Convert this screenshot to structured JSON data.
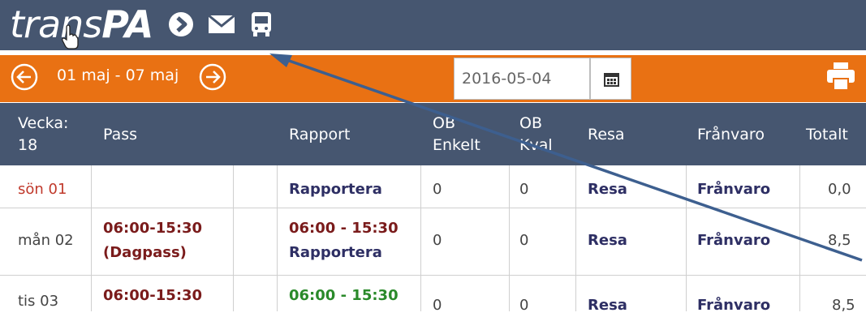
{
  "app": {
    "logo_part1": "trans",
    "logo_part2": "PA"
  },
  "icons": {
    "forward": "chevron-circle-icon",
    "mail": "envelope-icon",
    "bus": "bus-icon",
    "prev": "arrow-left-circle-icon",
    "next": "arrow-right-circle-icon",
    "calendar": "calendar-icon",
    "print": "printer-icon"
  },
  "colors": {
    "header": "#465670",
    "accent": "#e97113",
    "link": "#2e2f64",
    "sunday": "#c0392b",
    "pass": "#7a1b1b",
    "reported": "#2a8a2a"
  },
  "week_nav": {
    "range": "01 maj - 07 maj",
    "date_value": "2016-05-04"
  },
  "table": {
    "headers": {
      "week_line1": "Vecka:",
      "week_line2": "18",
      "pass": "Pass",
      "rapport": "Rapport",
      "ob_enkelt_1": "OB",
      "ob_enkelt_2": "Enkelt",
      "ob_kval_1": "OB",
      "ob_kval_2": "Kval",
      "resa": "Resa",
      "franvaro": "Frånvaro",
      "totalt": "Totalt"
    },
    "rows": [
      {
        "day": "sön 01",
        "pass1": "",
        "pass2": "",
        "rapport1": "Rapportera",
        "rapport2": "",
        "ob_enkelt": "0",
        "ob_kval": "0",
        "resa": "Resa",
        "franvaro": "Frånvaro",
        "totalt": "0,0"
      },
      {
        "day": "mån 02",
        "pass1": "06:00-15:30",
        "pass2": "(Dagpass)",
        "rapport1": "06:00 - 15:30",
        "rapport2": "Rapportera",
        "ob_enkelt": "0",
        "ob_kval": "0",
        "resa": "Resa",
        "franvaro": "Frånvaro",
        "totalt": "8,5"
      },
      {
        "day": "tis 03",
        "pass1": "06:00-15:30",
        "pass2": "",
        "rapport1": "06:00 - 15:30",
        "rapport2": "",
        "ob_enkelt": "0",
        "ob_kval": "0",
        "resa": "Resa",
        "franvaro": "Frånvaro",
        "totalt": "8,5"
      }
    ]
  }
}
